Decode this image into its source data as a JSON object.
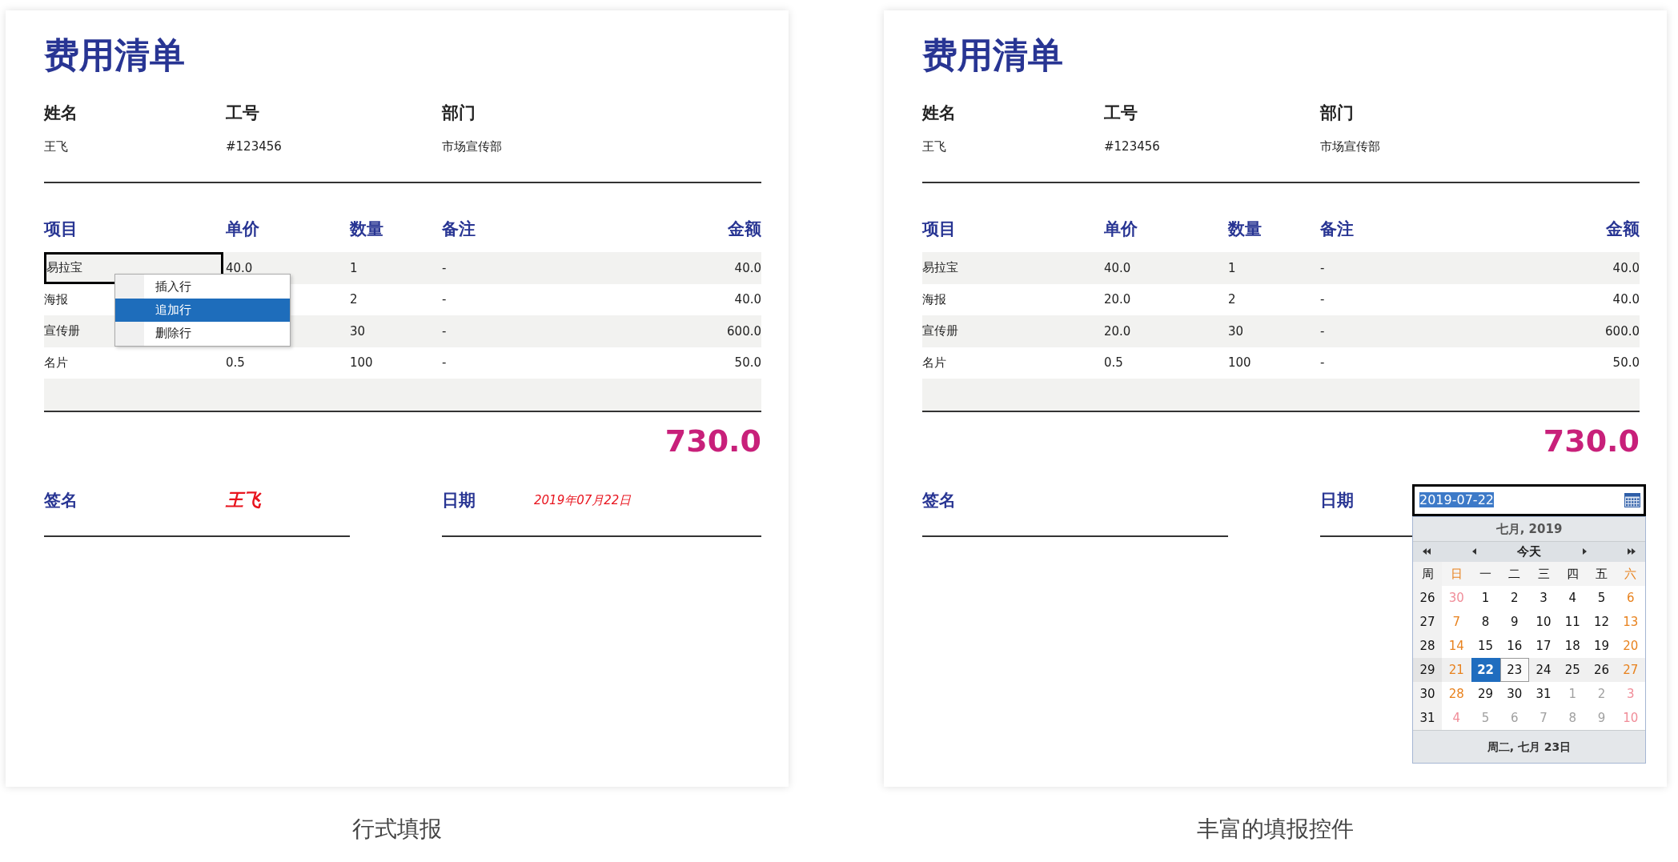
{
  "panels": [
    {
      "title": "费用清单",
      "info": [
        {
          "label": "姓名",
          "value": "王飞"
        },
        {
          "label": "工号",
          "value": "#123456"
        },
        {
          "label": "部门",
          "value": "市场宣传部"
        }
      ],
      "table": {
        "columns": [
          "项目",
          "单价",
          "数量",
          "备注",
          "金额"
        ],
        "rows": [
          {
            "cells": [
              "易拉宝",
              "40.0",
              "1",
              "-",
              "40.0"
            ],
            "selected": true
          },
          {
            "cells": [
              "海报",
              "",
              "2",
              "-",
              "40.0"
            ],
            "selected": false
          },
          {
            "cells": [
              "宣传册",
              "",
              "30",
              "-",
              "600.0"
            ],
            "selected": false
          },
          {
            "cells": [
              "名片",
              "0.5",
              "100",
              "-",
              "50.0"
            ],
            "selected": false
          }
        ]
      },
      "context_menu": [
        {
          "label": "插入行",
          "selected": false
        },
        {
          "label": "追加行",
          "selected": true
        },
        {
          "label": "删除行",
          "selected": false
        }
      ],
      "total": "730.0",
      "signature": {
        "label": "签名",
        "value": "王飞"
      },
      "date": {
        "label": "日期",
        "value": "2019年07月22日"
      },
      "caption": "行式填报"
    },
    {
      "title": "费用清单",
      "info": [
        {
          "label": "姓名",
          "value": "王飞"
        },
        {
          "label": "工号",
          "value": "#123456"
        },
        {
          "label": "部门",
          "value": "市场宣传部"
        }
      ],
      "table": {
        "columns": [
          "项目",
          "单价",
          "数量",
          "备注",
          "金额"
        ],
        "rows": [
          {
            "cells": [
              "易拉宝",
              "40.0",
              "1",
              "-",
              "40.0"
            ],
            "selected": false
          },
          {
            "cells": [
              "海报",
              "20.0",
              "2",
              "-",
              "40.0"
            ],
            "selected": false
          },
          {
            "cells": [
              "宣传册",
              "20.0",
              "30",
              "-",
              "600.0"
            ],
            "selected": false
          },
          {
            "cells": [
              "名片",
              "0.5",
              "100",
              "-",
              "50.0"
            ],
            "selected": false
          }
        ]
      },
      "total": "730.0",
      "signature": {
        "label": "签名"
      },
      "date": {
        "label": "日期",
        "input": "2019-07-22",
        "text_selected": true
      },
      "date_picker": {
        "title": "七月, 2019",
        "today_button": "今天",
        "week_label": "周",
        "weekdays": [
          {
            "label": "日",
            "weekend": true
          },
          {
            "label": "一",
            "weekend": false
          },
          {
            "label": "二",
            "weekend": false
          },
          {
            "label": "三",
            "weekend": false
          },
          {
            "label": "四",
            "weekend": false
          },
          {
            "label": "五",
            "weekend": false
          },
          {
            "label": "六",
            "weekend": true
          }
        ],
        "weeks": [
          {
            "number": "26",
            "selected": false,
            "days": [
              {
                "day": "30",
                "other_month": true,
                "weekend": true,
                "selected": false,
                "today": false
              },
              {
                "day": "1",
                "other_month": false,
                "weekend": false,
                "selected": false,
                "today": false
              },
              {
                "day": "2",
                "other_month": false,
                "weekend": false,
                "selected": false,
                "today": false
              },
              {
                "day": "3",
                "other_month": false,
                "weekend": false,
                "selected": false,
                "today": false
              },
              {
                "day": "4",
                "other_month": false,
                "weekend": false,
                "selected": false,
                "today": false
              },
              {
                "day": "5",
                "other_month": false,
                "weekend": false,
                "selected": false,
                "today": false
              },
              {
                "day": "6",
                "other_month": false,
                "weekend": true,
                "selected": false,
                "today": false
              }
            ]
          },
          {
            "number": "27",
            "selected": false,
            "days": [
              {
                "day": "7",
                "other_month": false,
                "weekend": true,
                "selected": false,
                "today": false
              },
              {
                "day": "8",
                "other_month": false,
                "weekend": false,
                "selected": false,
                "today": false
              },
              {
                "day": "9",
                "other_month": false,
                "weekend": false,
                "selected": false,
                "today": false
              },
              {
                "day": "10",
                "other_month": false,
                "weekend": false,
                "selected": false,
                "today": false
              },
              {
                "day": "11",
                "other_month": false,
                "weekend": false,
                "selected": false,
                "today": false
              },
              {
                "day": "12",
                "other_month": false,
                "weekend": false,
                "selected": false,
                "today": false
              },
              {
                "day": "13",
                "other_month": false,
                "weekend": true,
                "selected": false,
                "today": false
              }
            ]
          },
          {
            "number": "28",
            "selected": false,
            "days": [
              {
                "day": "14",
                "other_month": false,
                "weekend": true,
                "selected": false,
                "today": false
              },
              {
                "day": "15",
                "other_month": false,
                "weekend": false,
                "selected": false,
                "today": false
              },
              {
                "day": "16",
                "other_month": false,
                "weekend": false,
                "selected": false,
                "today": false
              },
              {
                "day": "17",
                "other_month": false,
                "weekend": false,
                "selected": false,
                "today": false
              },
              {
                "day": "18",
                "other_month": false,
                "weekend": false,
                "selected": false,
                "today": false
              },
              {
                "day": "19",
                "other_month": false,
                "weekend": false,
                "selected": false,
                "today": false
              },
              {
                "day": "20",
                "other_month": false,
                "weekend": true,
                "selected": false,
                "today": false
              }
            ]
          },
          {
            "number": "29",
            "selected": true,
            "days": [
              {
                "day": "21",
                "other_month": false,
                "weekend": true,
                "selected": false,
                "today": false
              },
              {
                "day": "22",
                "other_month": false,
                "weekend": false,
                "selected": true,
                "today": false
              },
              {
                "day": "23",
                "other_month": false,
                "weekend": false,
                "selected": false,
                "today": true
              },
              {
                "day": "24",
                "other_month": false,
                "weekend": false,
                "selected": false,
                "today": false
              },
              {
                "day": "25",
                "other_month": false,
                "weekend": false,
                "selected": false,
                "today": false
              },
              {
                "day": "26",
                "other_month": false,
                "weekend": false,
                "selected": false,
                "today": false
              },
              {
                "day": "27",
                "other_month": false,
                "weekend": true,
                "selected": false,
                "today": false
              }
            ]
          },
          {
            "number": "30",
            "selected": false,
            "days": [
              {
                "day": "28",
                "other_month": false,
                "weekend": true,
                "selected": false,
                "today": false
              },
              {
                "day": "29",
                "other_month": false,
                "weekend": false,
                "selected": false,
                "today": false
              },
              {
                "day": "30",
                "other_month": false,
                "weekend": false,
                "selected": false,
                "today": false
              },
              {
                "day": "31",
                "other_month": false,
                "weekend": false,
                "selected": false,
                "today": false
              },
              {
                "day": "1",
                "other_month": true,
                "weekend": false,
                "selected": false,
                "today": false
              },
              {
                "day": "2",
                "other_month": true,
                "weekend": false,
                "selected": false,
                "today": false
              },
              {
                "day": "3",
                "other_month": true,
                "weekend": true,
                "selected": false,
                "today": false
              }
            ]
          },
          {
            "number": "31",
            "selected": false,
            "days": [
              {
                "day": "4",
                "other_month": true,
                "weekend": true,
                "selected": false,
                "today": false
              },
              {
                "day": "5",
                "other_month": true,
                "weekend": false,
                "selected": false,
                "today": false
              },
              {
                "day": "6",
                "other_month": true,
                "weekend": false,
                "selected": false,
                "today": false
              },
              {
                "day": "7",
                "other_month": true,
                "weekend": false,
                "selected": false,
                "today": false
              },
              {
                "day": "8",
                "other_month": true,
                "weekend": false,
                "selected": false,
                "today": false
              },
              {
                "day": "9",
                "other_month": true,
                "weekend": false,
                "selected": false,
                "today": false
              },
              {
                "day": "10",
                "other_month": true,
                "weekend": true,
                "selected": false,
                "today": false
              }
            ]
          }
        ],
        "footer": "周二, 七月 23日"
      },
      "caption": "丰富的填报控件"
    }
  ]
}
